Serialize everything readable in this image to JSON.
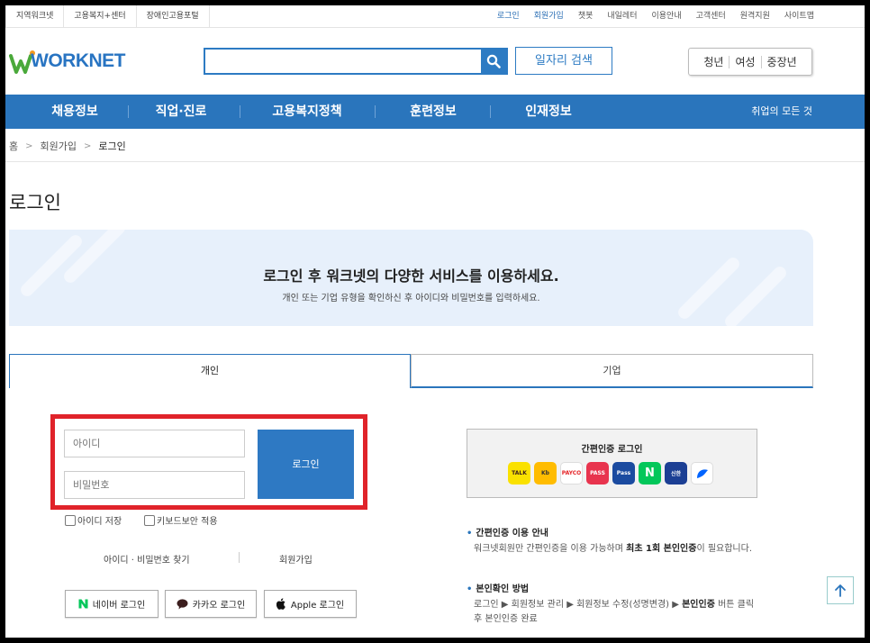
{
  "utility": {
    "left": [
      "지역워크넷",
      "고용복지+센터",
      "장애인고용포털"
    ],
    "right": [
      {
        "label": "로그인",
        "accent": true
      },
      {
        "label": "회원가입",
        "accent": true
      },
      {
        "label": "챗봇",
        "accent": false
      },
      {
        "label": "내일레터",
        "accent": false
      },
      {
        "label": "이용안내",
        "accent": false
      },
      {
        "label": "고객센터",
        "accent": false
      },
      {
        "label": "원격지원",
        "accent": false
      },
      {
        "label": "사이트맵",
        "accent": false
      }
    ]
  },
  "header": {
    "logo": "WORKNET",
    "search_value": "",
    "job_search_label": "일자리 검색",
    "target_groups": [
      "청년",
      "여성",
      "중장년"
    ]
  },
  "gnb": {
    "items": [
      "채용정보",
      "직업·진로",
      "고용복지정책",
      "훈련정보",
      "인재정보"
    ],
    "all_menu": "취업의 모든 것"
  },
  "breadcrumb": [
    "홈",
    "회원가입",
    "로그인"
  ],
  "page_title": "로그인",
  "banner": {
    "title": "로그인 후 워크넷의 다양한 서비스를 이용하세요.",
    "subtitle": "개인 또는 기업 유형을 확인하신 후 아이디와 비밀번호를 입력하세요."
  },
  "tabs": {
    "individual": "개인",
    "company": "기업"
  },
  "login": {
    "id_placeholder": "아이디",
    "pw_placeholder": "비밀번호",
    "login_button": "로그인",
    "save_id": "아이디 저장",
    "keyboard_security": "키보드보안 적용",
    "find_id_pw": "아이디 · 비밀번호 찾기",
    "join": "회원가입"
  },
  "social": {
    "naver": "네이버 로그인",
    "kakao": "카카오 로그인",
    "apple": "Apple 로그인"
  },
  "easy_auth": {
    "title": "간편인증 로그인",
    "providers": [
      {
        "name": "kakao-talk",
        "label": "TALK",
        "bg": "#fae100",
        "fg": "#3c1e1e"
      },
      {
        "name": "kb",
        "label": "Kb",
        "bg": "#ffbc00",
        "fg": "#333333"
      },
      {
        "name": "payco",
        "label": "PAYCO",
        "bg": "#ffffff",
        "fg": "#e52528"
      },
      {
        "name": "pass",
        "label": "PASS",
        "bg": "#e8344e",
        "fg": "#ffffff"
      },
      {
        "name": "samsung-pass",
        "label": "Pass",
        "bg": "#1b4ba0",
        "fg": "#ffffff"
      },
      {
        "name": "naver",
        "label": "N",
        "bg": "#03c75a",
        "fg": "#ffffff"
      },
      {
        "name": "shinhan",
        "label": "신한",
        "bg": "#1c3f94",
        "fg": "#ffffff"
      },
      {
        "name": "toss",
        "label": "",
        "bg": "#ffffff",
        "fg": "#0064ff"
      }
    ]
  },
  "info": {
    "head1": "간편인증 이용 안내",
    "text1_a": "워크넷회원만 간편인증을 이용 가능하며 ",
    "text1_b": "최초 1회 본인인증",
    "text1_c": "이 필요합니다.",
    "head2": "본인확인 방법",
    "text2_a": "로그인 ▶ 회원정보 관리 ▶ 회원정보 수정(성명변경) ▶ ",
    "text2_b": "본인인증",
    "text2_c": " 버튼 클릭 후 본인인증 완료"
  },
  "colors": {
    "brand": "#2a75bc",
    "highlight": "#e0232a",
    "banner": "#e7f0fb"
  }
}
